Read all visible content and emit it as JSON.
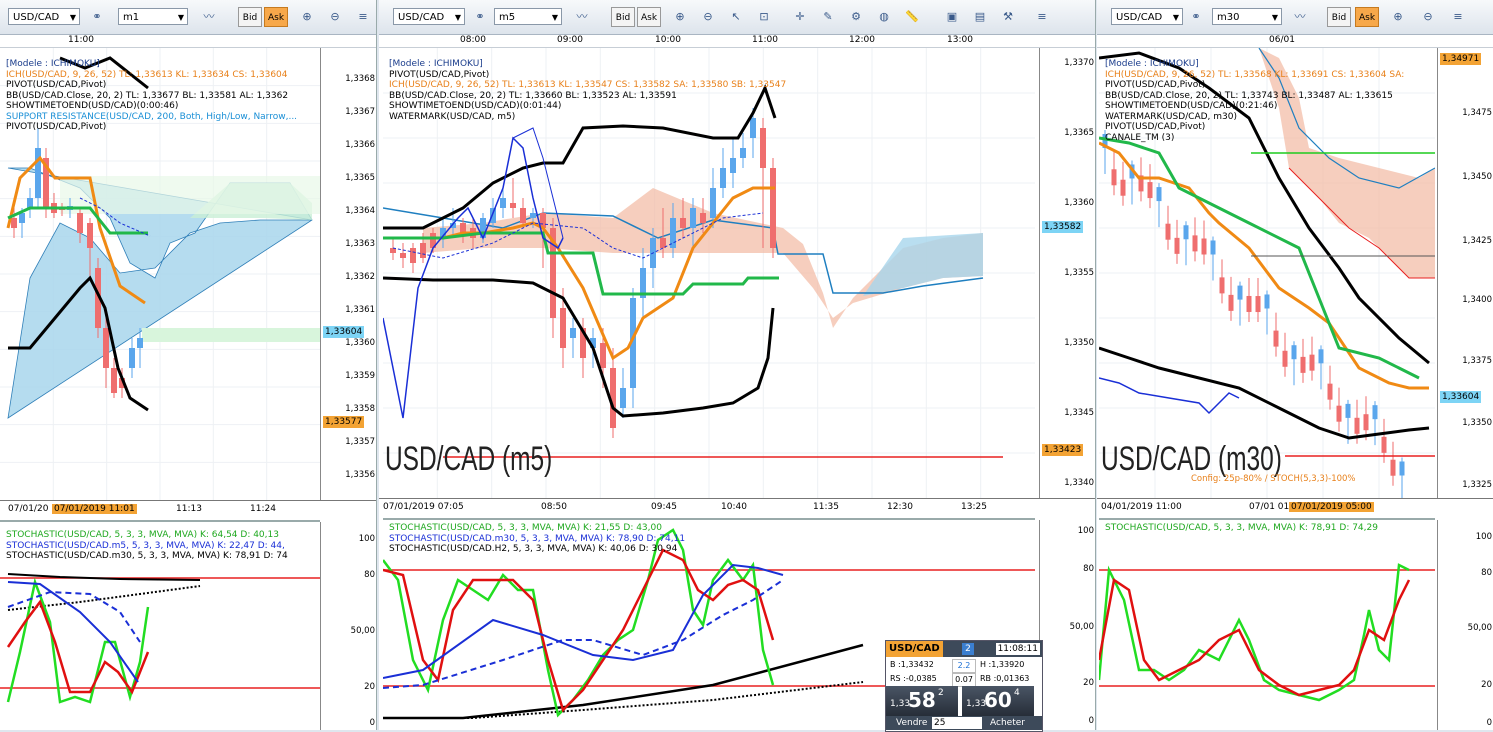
{
  "panes": [
    {
      "symbol": "USD/CAD",
      "period": "m1",
      "top_times": [
        {
          "t": "11:00"
        }
      ],
      "price_ticks": [
        "1,3368",
        "1,3367",
        "1,3366",
        "1,3365",
        "1,3364",
        "1,3363",
        "1,3362",
        "1,3361",
        "1,3360",
        "1,3359",
        "1,3358",
        "1,3357",
        "1,3356"
      ],
      "price_tags": [
        {
          "label": "1,33604",
          "color": "#7dd4f5"
        },
        {
          "label": "1,33577",
          "color": "#f3a334"
        }
      ],
      "legend": [
        {
          "text": "[Modele : ICHIMOKU]",
          "color": "#1b3d8c"
        },
        {
          "text": "ICH(USD/CAD, 9, 26, 52)  TL: 1,33613  KL: 1,33634  CS: 1,33604",
          "color": "#e8801a"
        },
        {
          "text": "PIVOT(USD/CAD,Pivot)",
          "color": "#000"
        },
        {
          "text": "BB(USD/CAD.Close, 20, 2)  TL: 1,33677  BL: 1,33581  AL: 1,3362",
          "color": "#000"
        },
        {
          "text": "SHOWTIMETOEND(USD/CAD)(0:00:46)",
          "color": "#000"
        },
        {
          "text": "SUPPORT RESISTANCE(USD/CAD, 200, Both, High/Low, Narrow,...",
          "color": "#1a8fd6"
        },
        {
          "text": "PIVOT(USD/CAD,Pivot)",
          "color": "#000"
        }
      ],
      "bottom_times": [
        "07/01/20",
        "07/01/2019 11:01",
        "11:13",
        "11:24"
      ],
      "stoch_legend": [
        {
          "text": "STOCHASTIC(USD/CAD, 5, 3, 3, MVA, MVA)  K: 64,54  D: 40,13",
          "color": "#1fa81f"
        },
        {
          "text": "STOCHASTIC(USD/CAD.m5, 5, 3, 3, MVA, MVA)  K: 22,47  D: 44,",
          "color": "#1a2fd6"
        },
        {
          "text": "STOCHASTIC(USD/CAD.m30, 5, 3, 3, MVA, MVA)  K: 78,91  D: 74",
          "color": "#000"
        }
      ],
      "stoch_ticks": [
        "100",
        "80",
        "50,00",
        "20",
        "0"
      ]
    },
    {
      "symbol": "USD/CAD",
      "period": "m5",
      "top_times": [
        {
          "t": "08:00"
        },
        {
          "t": "09:00"
        },
        {
          "t": "10:00"
        },
        {
          "t": "11:00"
        },
        {
          "t": "12:00"
        },
        {
          "t": "13:00"
        }
      ],
      "price_ticks": [
        "1,3370",
        "1,3365",
        "1,3360",
        "1,3355",
        "1,3350",
        "1,3345",
        "1,3340"
      ],
      "price_tags": [
        {
          "label": "1,33582",
          "color": "#7dd4f5"
        },
        {
          "label": "1,33423",
          "color": "#f3a334"
        }
      ],
      "legend": [
        {
          "text": "[Modele : ICHIMOKU]",
          "color": "#1b3d8c"
        },
        {
          "text": "PIVOT(USD/CAD,Pivot)",
          "color": "#000"
        },
        {
          "text": "ICH(USD/CAD, 9, 26, 52)  TL: 1,33613  KL: 1,33547  CS: 1,33582  SA: 1,33580  SB: 1,33547",
          "color": "#e8801a"
        },
        {
          "text": "BB(USD/CAD.Close, 20, 2)  TL: 1,33660  BL: 1,33523  AL: 1,33591",
          "color": "#000"
        },
        {
          "text": "SHOWTIMETOEND(USD/CAD)(0:01:44)",
          "color": "#000"
        },
        {
          "text": "WATERMARK(USD/CAD, m5)",
          "color": "#000"
        }
      ],
      "watermark": "USD/CAD (m5)",
      "bottom_times": [
        "07/01/2019 07:05",
        "08:50",
        "09:45",
        "10:40",
        "11:35",
        "12:30",
        "13:25"
      ],
      "stoch_legend": [
        {
          "text": "STOCHASTIC(USD/CAD, 5, 3, 3, MVA, MVA)  K: 21,55  D: 43,00",
          "color": "#1fa81f"
        },
        {
          "text": "STOCHASTIC(USD/CAD.m30, 5, 3, 3, MVA, MVA)  K: 78,90  D: 74,11",
          "color": "#1a2fd6"
        },
        {
          "text": "STOCHASTIC(USD/CAD.H2, 5, 3, 3, MVA, MVA)  K: 40,06  D: 30,94",
          "color": "#000"
        }
      ],
      "stoch_ticks": [
        "100",
        "80",
        "50,00",
        "20",
        "0"
      ]
    },
    {
      "symbol": "USD/CAD",
      "period": "m30",
      "top_times": [
        {
          "t": "06/01"
        }
      ],
      "price_ticks": [
        "1,3475",
        "1,3450",
        "1,3425",
        "1,3400",
        "1,3375",
        "1,3350",
        "1,3325"
      ],
      "price_tags": [
        {
          "label": "1,34971",
          "color": "#f3a334"
        },
        {
          "label": "1,33604",
          "color": "#7dd4f5"
        }
      ],
      "legend": [
        {
          "text": "[Modele : ICHIMOKU]",
          "color": "#1b3d8c"
        },
        {
          "text": "ICH(USD/CAD, 9, 26, 52)  TL: 1,33568  KL: 1,33691  CS: 1,33604  SA:",
          "color": "#e8801a"
        },
        {
          "text": "PIVOT(USD/CAD,Pivot)",
          "color": "#000"
        },
        {
          "text": "BB(USD/CAD.Close, 20, 2)  TL: 1,33743  BL: 1,33487  AL: 1,33615",
          "color": "#000"
        },
        {
          "text": "SHOWTIMETOEND(USD/CAD)(0:21:46)",
          "color": "#000"
        },
        {
          "text": "WATERMARK(USD/CAD, m30)",
          "color": "#000"
        },
        {
          "text": "PIVOT(USD/CAD,Pivot)",
          "color": "#000"
        },
        {
          "text": "CANALE_TM (3)",
          "color": "#000"
        }
      ],
      "watermark": "USD/CAD (m30)",
      "config_note": "Config: 25p-80% / STOCH(5,3,3)-100%",
      "bottom_times": [
        "04/01/2019 11:00",
        "07/01 01:",
        "07/01/2019 05:00"
      ],
      "stoch_legend": [
        {
          "text": "STOCHASTIC(USD/CAD, 5, 3, 3, MVA, MVA)  K: 78,91  D: 74,29",
          "color": "#1fa81f"
        }
      ],
      "stoch_ticks": [
        "100",
        "80",
        "50,00",
        "20",
        "0"
      ]
    }
  ],
  "trade_panel": {
    "symbol": "USD/CAD",
    "badge": "2",
    "time": "11:08:11",
    "bid_label": "B :1,33432",
    "spread": "2.2",
    "high_label": "H :1,33920",
    "rs_label": "RS :-0,0385",
    "rs_val": "0.07",
    "rb_label": "RB :0,01363",
    "sell_prefix": "1,33",
    "sell_big": "58",
    "sell_sup": "2",
    "buy_prefix": "1,33",
    "buy_big": "60",
    "buy_sup": "4",
    "sell_label": "Vendre",
    "qty": "25",
    "buy_label": "Acheter"
  },
  "colors": {
    "tenkan": "#f08a14",
    "kijun": "#21b84a",
    "bb": "#000000",
    "cloud_up": "#f2b9a3",
    "cloud_down": "#a8d6ec",
    "candle_up": "#5aa6ec",
    "candle_down": "#ef6e6e",
    "stoch_k": "#22dd22",
    "stoch_d": "#e01010",
    "ref_red": "#e82020"
  }
}
